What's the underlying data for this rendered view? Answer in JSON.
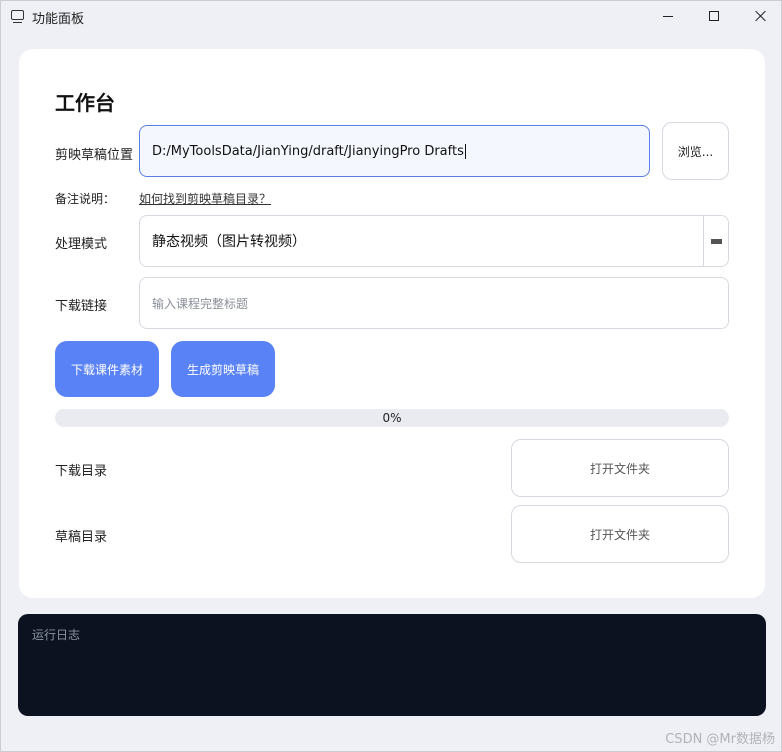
{
  "window": {
    "title": "功能面板",
    "controls": {
      "minimize": "minimize",
      "maximize": "maximize",
      "close": "close"
    }
  },
  "main": {
    "heading": "工作台",
    "draft_location": {
      "label": "剪映草稿位置",
      "value": "D:/MyToolsData/JianYing/draft/JianyingPro Drafts",
      "browse_label": "浏览..."
    },
    "note": {
      "label": "备注说明：",
      "link_text": "如何找到剪映草稿目录？"
    },
    "mode": {
      "label": "处理模式",
      "selected": "静态视频（图片转视频）"
    },
    "download_link": {
      "label": "下载链接",
      "placeholder": "输入课程完整标题"
    },
    "actions": {
      "download_label": "下载课件素材",
      "generate_label": "生成剪映草稿"
    },
    "progress": {
      "value": 0,
      "text": "0%"
    },
    "download_dir": {
      "label": "下载目录",
      "button_label": "打开文件夹"
    },
    "draft_dir": {
      "label": "草稿目录",
      "button_label": "打开文件夹"
    }
  },
  "log": {
    "title": "运行日志"
  },
  "watermark": "CSDN @Mr数据杨",
  "colors": {
    "accent": "#5a82f7",
    "log_bg": "#0c1220",
    "focus_border": "#5b7ee6"
  }
}
